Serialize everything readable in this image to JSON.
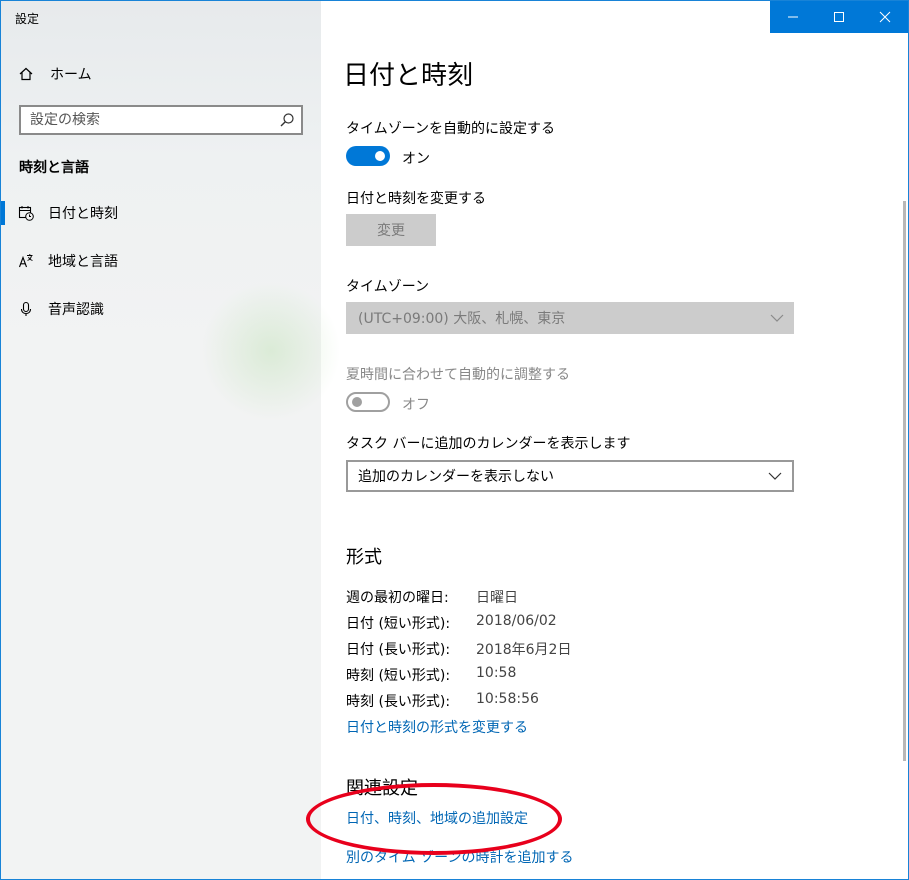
{
  "window": {
    "title": "設定"
  },
  "sidebar": {
    "home_label": "ホーム",
    "search_placeholder": "設定の検索",
    "section_heading": "時刻と言語",
    "items": [
      {
        "label": "日付と時刻",
        "icon": "calendar-clock-icon",
        "active": true
      },
      {
        "label": "地域と言語",
        "icon": "language-icon",
        "active": false
      },
      {
        "label": "音声認識",
        "icon": "microphone-icon",
        "active": false
      }
    ]
  },
  "main": {
    "page_title": "日付と時刻",
    "auto_timezone": {
      "label": "タイムゾーンを自動的に設定する",
      "state": "オン"
    },
    "change_datetime": {
      "label": "日付と時刻を変更する",
      "button": "変更"
    },
    "timezone": {
      "label": "タイムゾーン",
      "value": "(UTC+09:00) 大阪、札幌、東京"
    },
    "dst": {
      "label": "夏時間に合わせて自動的に調整する",
      "state": "オフ"
    },
    "calendar": {
      "label": "タスク バーに追加のカレンダーを表示します",
      "value": "追加のカレンダーを表示しない"
    },
    "format": {
      "heading": "形式",
      "rows": [
        {
          "key": "週の最初の曜日:",
          "value": "日曜日"
        },
        {
          "key": "日付 (短い形式):",
          "value": "2018/06/02"
        },
        {
          "key": "日付 (長い形式):",
          "value": "2018年6月2日"
        },
        {
          "key": "時刻 (短い形式):",
          "value": "10:58"
        },
        {
          "key": "時刻 (長い形式):",
          "value": "10:58:56"
        }
      ],
      "change_link": "日付と時刻の形式を変更する"
    },
    "related": {
      "heading": "関連設定",
      "links": [
        "日付、時刻、地域の追加設定",
        "別のタイム ゾーンの時計を追加する"
      ]
    }
  },
  "colors": {
    "accent": "#0078d7",
    "link": "#0066b4",
    "annotation": "#e8001c"
  }
}
